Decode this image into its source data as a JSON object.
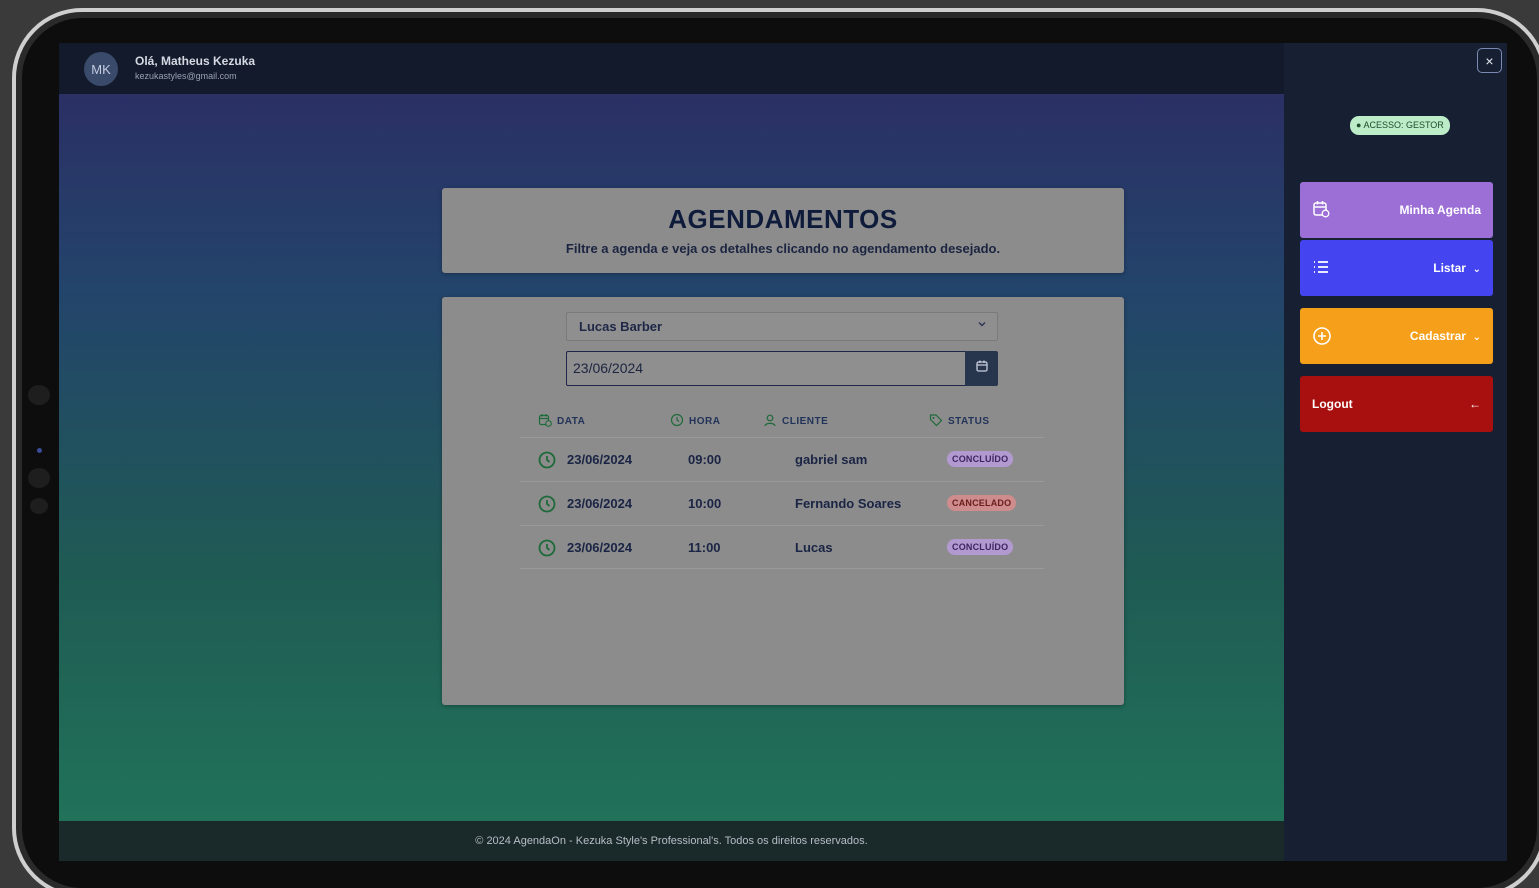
{
  "user": {
    "initials": "MK",
    "greeting": "Olá,  Matheus Kezuka",
    "email": "kezukastyles@gmail.com"
  },
  "header_card": {
    "title": "AGENDAMENTOS",
    "subtitle": "Filtre a agenda e veja os detalhes clicando no agendamento desejado."
  },
  "filters": {
    "professional": "Lucas Barber",
    "date": "23/06/2024"
  },
  "table": {
    "headers": {
      "data": "DATA",
      "hora": "HORA",
      "cliente": "CLIENTE",
      "status": "STATUS"
    },
    "rows": [
      {
        "date": "23/06/2024",
        "time": "09:00",
        "client": "gabriel sam",
        "status": "CONCLUÍDO"
      },
      {
        "date": "23/06/2024",
        "time": "10:00",
        "client": "Fernando Soares",
        "status": "CANCELADO"
      },
      {
        "date": "23/06/2024",
        "time": "11:00",
        "client": "Lucas",
        "status": "CONCLUÍDO"
      }
    ]
  },
  "footer": {
    "text": "© 2024 AgendaOn - Kezuka Style's Professional's. Todos os direitos reservados."
  },
  "sidebar": {
    "close_label": "×",
    "role": "● ACESSO: GESTOR",
    "buttons": {
      "agenda": "Minha Agenda",
      "listar": "Listar",
      "listar_chevron": "⌄",
      "cadastrar": "Cadastrar",
      "cadastrar_chevron": "⌄",
      "logout": "Logout",
      "logout_arrow": "←"
    }
  },
  "colors": {
    "agenda": "#9c6fd6",
    "listar": "#4444f0",
    "cadastrar": "#f59f1a",
    "logout": "#a80f0f",
    "status_done": "#b29ad1",
    "status_cancel": "#cf8c8c"
  }
}
